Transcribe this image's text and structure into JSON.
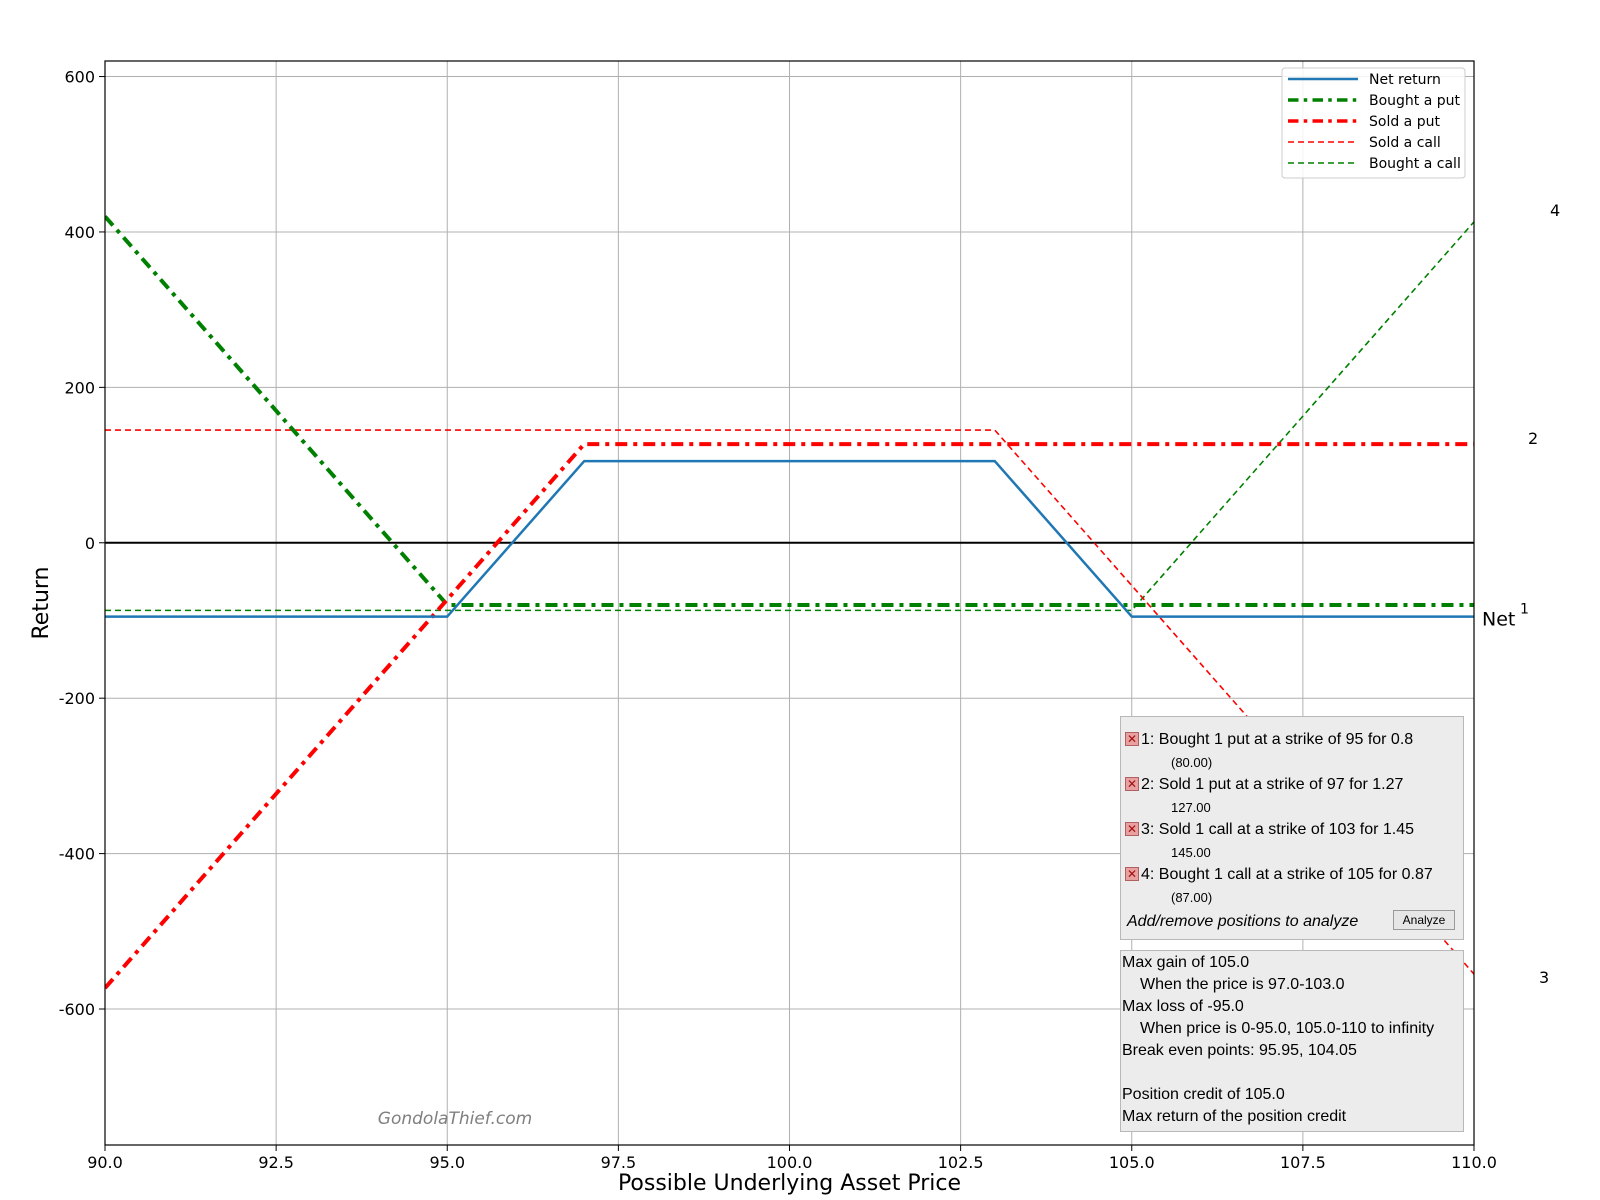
{
  "chart_data": {
    "type": "line",
    "xlabel": "Possible Underlying Asset Price",
    "ylabel": "Return",
    "xlim": [
      90,
      110
    ],
    "ylim": [
      -775,
      620
    ],
    "x_ticks": [
      "90.0",
      "92.5",
      "95.0",
      "97.5",
      "100.0",
      "102.5",
      "105.0",
      "107.5",
      "110.0"
    ],
    "y_ticks": [
      "600",
      "400",
      "200",
      "0",
      "-200",
      "-400",
      "-600"
    ],
    "grid": true,
    "legend_position": "top-right",
    "watermark": "GondolaThief.com",
    "series": [
      {
        "name": "Net return",
        "color": "#1f77b4",
        "style": "solid",
        "width": 2.5,
        "x": [
          90,
          95,
          97,
          103,
          105,
          110
        ],
        "y": [
          -95,
          -95,
          105,
          105,
          -95,
          -95
        ]
      },
      {
        "name": "Bought a put",
        "color": "#008000",
        "style": "dashdot",
        "width": 4,
        "x": [
          90,
          95,
          110
        ],
        "y": [
          420,
          -80,
          -80
        ]
      },
      {
        "name": "Sold a put",
        "color": "#ff0000",
        "style": "dashdot",
        "width": 4,
        "x": [
          90,
          97,
          110
        ],
        "y": [
          -573,
          127,
          127
        ]
      },
      {
        "name": "Sold a call",
        "color": "#ff0000",
        "style": "dashed",
        "width": 1.6,
        "x": [
          90,
          103,
          110
        ],
        "y": [
          145,
          145,
          -555
        ]
      },
      {
        "name": "Bought a call",
        "color": "#008000",
        "style": "dashed",
        "width": 1.6,
        "x": [
          90,
          105,
          110
        ],
        "y": [
          -87,
          -87,
          413
        ]
      }
    ],
    "line_labels": [
      {
        "text": "Net",
        "superscript": "1",
        "x": 110,
        "y": -95
      },
      {
        "text": "2",
        "x": 110,
        "y": 127
      },
      {
        "text": "3",
        "x": 110,
        "y": -560
      },
      {
        "text": "4",
        "x": 110,
        "y": 413
      }
    ]
  },
  "positions": [
    {
      "label": "1: Bought 1 put at a strike of 95 for 0.8",
      "amount": "(80.00)"
    },
    {
      "label": "2: Sold 1 put at a strike of 97 for 1.27",
      "amount": "127.00"
    },
    {
      "label": "3: Sold 1 call at a strike of 103 for 1.45",
      "amount": "145.00"
    },
    {
      "label": "4: Bought 1 call at a strike of 105 for 0.87",
      "amount": "(87.00)"
    }
  ],
  "remove_icon": "close-x-icon",
  "add_remove_label": "Add/remove positions to analyze",
  "analyze_label": "Analyze",
  "summary": {
    "max_gain": "Max gain of 105.0",
    "max_gain_when": "When the price is 97.0-103.0",
    "max_loss": "Max loss of -95.0",
    "max_loss_when": "When price is 0-95.0, 105.0-110 to infinity",
    "break_even": "Break even points: 95.95, 104.05",
    "credit": "Position credit of 105.0",
    "max_return": "Max return of the position credit"
  }
}
